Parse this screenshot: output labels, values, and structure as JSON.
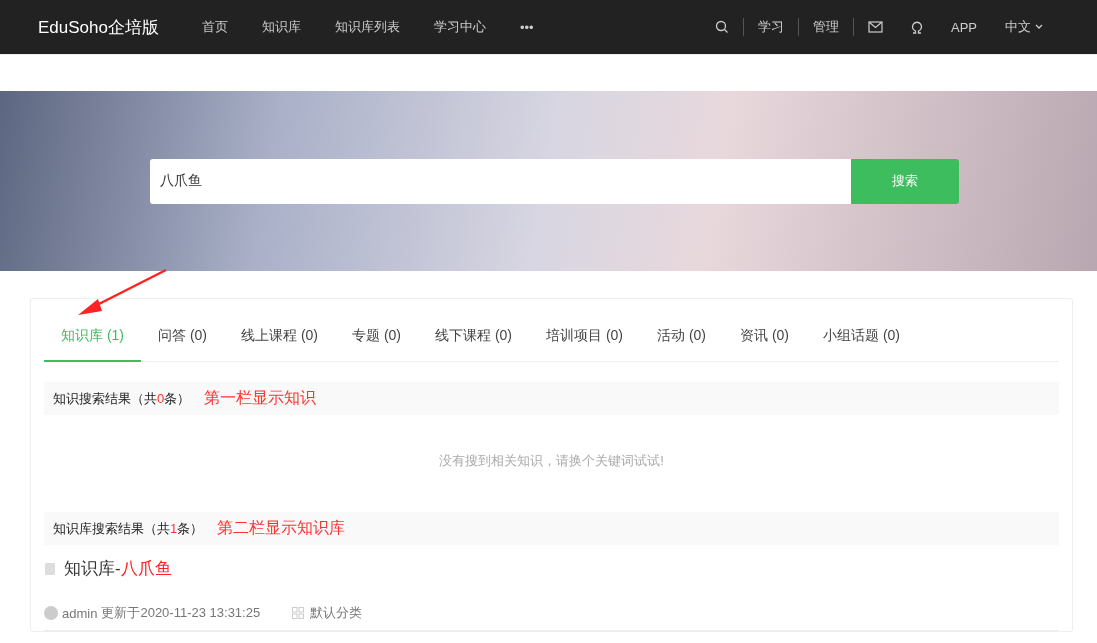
{
  "nav": {
    "brand": "EduSoho企培版",
    "links": [
      "首页",
      "知识库",
      "知识库列表",
      "学习中心",
      "•••"
    ],
    "right": [
      {
        "kind": "search"
      },
      {
        "kind": "text",
        "label": "学习"
      },
      {
        "kind": "text",
        "label": "管理"
      },
      {
        "kind": "mail"
      },
      {
        "kind": "omega"
      },
      {
        "kind": "plain",
        "label": "APP"
      },
      {
        "kind": "lang",
        "label": "中文"
      }
    ]
  },
  "search": {
    "value": "八爪鱼",
    "button": "搜索"
  },
  "tabs": [
    {
      "label": "知识库 (1)",
      "selected": true
    },
    {
      "label": "问答 (0)",
      "selected": false
    },
    {
      "label": "线上课程 (0)",
      "selected": false
    },
    {
      "label": "专题 (0)",
      "selected": false
    },
    {
      "label": "线下课程 (0)",
      "selected": false
    },
    {
      "label": "培训项目 (0)",
      "selected": false
    },
    {
      "label": "活动 (0)",
      "selected": false
    },
    {
      "label": "资讯 (0)",
      "selected": false
    },
    {
      "label": "小组话题 (0)",
      "selected": false
    }
  ],
  "sections": [
    {
      "prefix": "知识搜索结果（共",
      "count": "0",
      "suffix": "条）",
      "note": "第一栏显示知识",
      "empty": "没有搜到相关知识，请换个关键词试试!"
    },
    {
      "prefix": "知识库搜索结果（共",
      "count": "1",
      "suffix": "条）",
      "note": "第二栏显示知识库",
      "results": [
        {
          "title": "知识库-",
          "highlight": "八爪鱼",
          "author": "admin",
          "updated": "更新于2020-11-23 13:31:25",
          "category": "默认分类"
        }
      ]
    }
  ]
}
